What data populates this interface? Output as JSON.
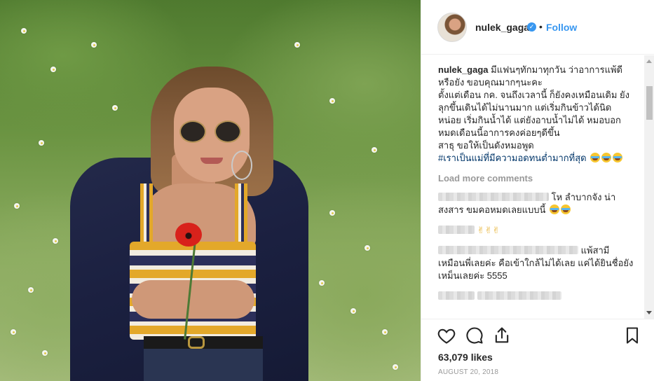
{
  "post": {
    "username": "nulek_gaga",
    "verified_mark": "✓",
    "separator": "•",
    "follow_label": "Follow"
  },
  "caption": {
    "user": "nulek_gaga",
    "line1": "มีแฟนๆทักมาทุกวัน ว่าอาการแพ้ดีหรือยัง ขอบคุณมากๆนะคะ",
    "line2": "ตั้งแต่เดือน กค. จนถึงเวลานี้ ก็ยังคงเหมือนเดิม ยังลุกขึ้นเดินได้ไม่นานมาก แต่เริ่มกินข้าวได้นิดหน่อย เริ่มกินน้ำได้ แต่ยังอาบน้ำไม่ได้ หมอบอกหมดเดือนนี้อาการคงค่อยๆดีขึ้น",
    "line3": "สาธุ ขอให้เป็นดังหมอพูด",
    "hashtag": "#เราเป็นแม่ที่มีความอดทนต่ำมากที่สุด"
  },
  "load_more_label": "Load more comments",
  "comments": [
    {
      "text": "โห ลำบากจัง น่าสงสาร ขมคอหมดเลยแบบนี้"
    },
    {
      "text": "✌✌✌"
    },
    {
      "text": "แพ้สามีเหมือนพี่เลยค่ะ คือเข้าใกล้ไม่ได้เลย แค่ได้ยินชื่อยังเหม็นเลยค่ะ 5555"
    },
    {
      "text": ""
    }
  ],
  "stats": {
    "likes": "63,079 likes",
    "date": "AUGUST 20, 2018"
  },
  "icons": {
    "like": "heart-icon",
    "comment": "comment-icon",
    "share": "share-icon",
    "save": "bookmark-icon"
  },
  "colors": {
    "link_blue": "#3897f0",
    "text": "#262626",
    "muted": "#999999"
  }
}
